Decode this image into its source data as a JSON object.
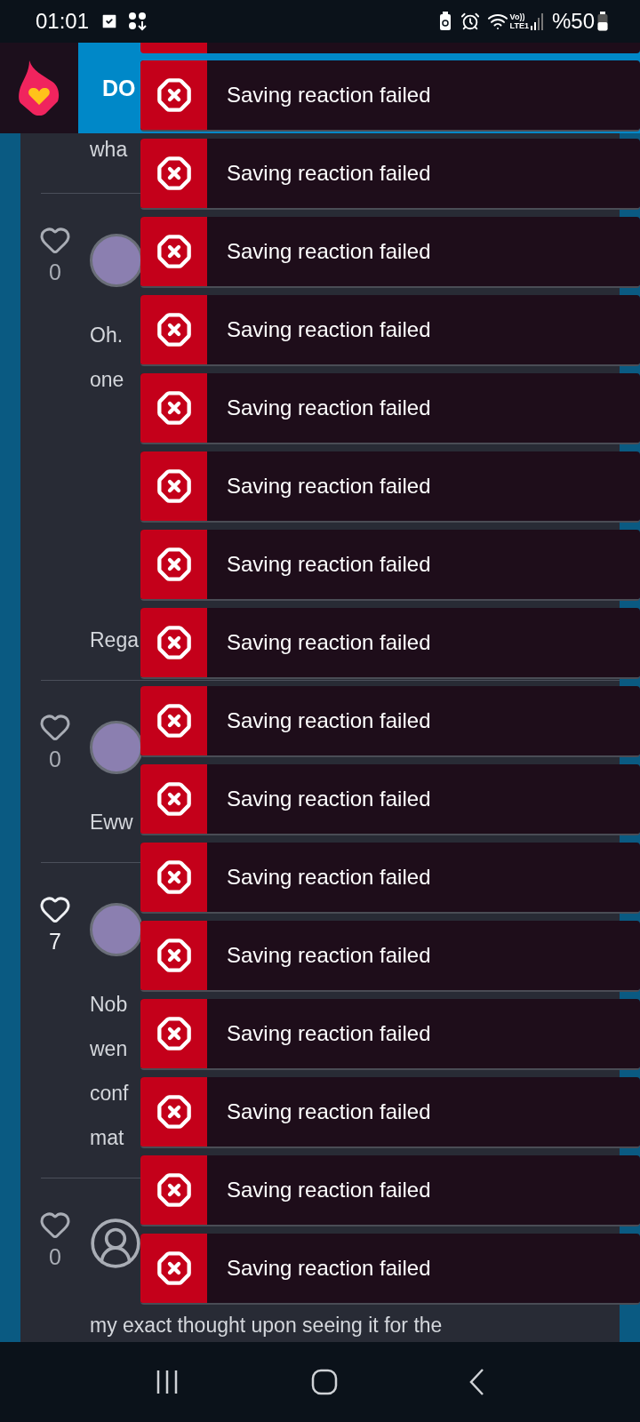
{
  "status_bar": {
    "time": "01:01",
    "volte": "Vo))",
    "network": "LTE1",
    "battery": "%50"
  },
  "header": {
    "title": "DO"
  },
  "comments": [
    {
      "kind": "partial",
      "paragraphs": [
        [
          "wha"
        ]
      ]
    },
    {
      "kind": "photo",
      "likes": "0",
      "active": false,
      "paragraphs": [
        [
          "Oh.",
          "one"
        ],
        [
          "Rega"
        ]
      ]
    },
    {
      "kind": "photo",
      "likes": "0",
      "active": false,
      "paragraphs": [
        [
          "Eww"
        ]
      ]
    },
    {
      "kind": "photo",
      "likes": "7",
      "active": true,
      "paragraphs": [
        [
          "Nob",
          "wen",
          "conf",
          "mat"
        ]
      ]
    },
    {
      "kind": "anonymous",
      "likes": "0",
      "active": false,
      "paragraphs": [
        [
          "my exact thought upon seeing it for the"
        ]
      ]
    }
  ],
  "toasts": [
    {
      "kind": "error",
      "message": "Saving reaction failed"
    },
    {
      "kind": "error",
      "message": "Saving reaction failed"
    },
    {
      "kind": "error",
      "message": "Saving reaction failed"
    },
    {
      "kind": "error",
      "message": "Saving reaction failed"
    },
    {
      "kind": "error",
      "message": "Saving reaction failed"
    },
    {
      "kind": "error",
      "message": "Saving reaction failed"
    },
    {
      "kind": "error",
      "message": "Saving reaction failed"
    },
    {
      "kind": "error",
      "message": "Saving reaction failed"
    },
    {
      "kind": "error",
      "message": "Saving reaction failed"
    },
    {
      "kind": "error",
      "message": "Saving reaction failed"
    },
    {
      "kind": "error",
      "message": "Saving reaction failed"
    },
    {
      "kind": "error",
      "message": "Saving reaction failed"
    },
    {
      "kind": "error",
      "message": "Saving reaction failed"
    },
    {
      "kind": "error",
      "message": "Saving reaction failed"
    },
    {
      "kind": "error",
      "message": "Saving reaction failed"
    },
    {
      "kind": "error",
      "message": "Saving reaction failed"
    }
  ]
}
